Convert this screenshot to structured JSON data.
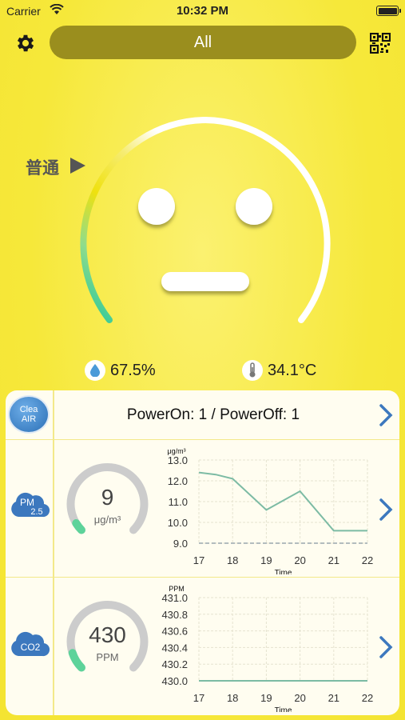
{
  "status_bar": {
    "carrier": "Carrier",
    "time": "10:32 PM"
  },
  "header": {
    "filter_label": "All",
    "settings_icon": "gear-icon",
    "scan_icon": "qr-code-icon"
  },
  "air_status": {
    "level_label": "普通",
    "humidity": "67.5%",
    "temperature": "34.1°C"
  },
  "power_row": {
    "logo_text_1": "Clea",
    "logo_text_2": "AIR",
    "text": "PowerOn: 1 / PowerOff: 1"
  },
  "pm25": {
    "cloud_label": "PM",
    "cloud_sub": "2.5",
    "value": "9",
    "unit": "μg/m³",
    "gauge_fraction": 0.05,
    "chart_data": {
      "type": "line",
      "ylabel": "μg/m³",
      "xlabel": "Time",
      "x": [
        17,
        17.5,
        18,
        19,
        20,
        21,
        22
      ],
      "y": [
        12.4,
        12.3,
        12.1,
        10.6,
        11.5,
        9.6,
        9.6
      ],
      "yticks": [
        "13.0",
        "12.0",
        "11.0",
        "10.0",
        "9.0"
      ],
      "xticks": [
        "17",
        "18",
        "19",
        "20",
        "21",
        "22"
      ],
      "ylim": [
        9.0,
        13.0
      ],
      "xlim": [
        17,
        22
      ],
      "line_color": "#7cbba4"
    }
  },
  "co2": {
    "cloud_label": "CO2",
    "value": "430",
    "unit": "PPM",
    "gauge_fraction": 0.1,
    "chart_data": {
      "type": "line",
      "ylabel": "PPM",
      "xlabel": "Time",
      "x": [
        17,
        22
      ],
      "y": [
        430.0,
        430.0
      ],
      "yticks": [
        "431.0",
        "430.8",
        "430.6",
        "430.4",
        "430.2",
        "430.0"
      ],
      "xticks": [
        "17",
        "18",
        "19",
        "20",
        "21",
        "22"
      ],
      "ylim": [
        430.0,
        431.0
      ],
      "xlim": [
        17,
        22
      ],
      "line_color": "#7cbba4"
    }
  },
  "colors": {
    "background": "#f6e83a",
    "pill": "#9a8e1e",
    "accent_blue": "#3c78be",
    "gauge_green": "#5dd39a"
  }
}
